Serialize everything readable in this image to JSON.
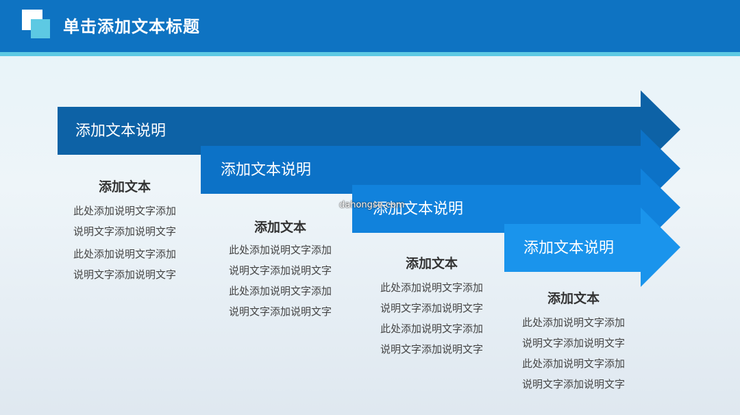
{
  "header": {
    "title": "单击添加文本标题",
    "bar_color": "#0e73c2",
    "stripe_color": "#5dc9e3"
  },
  "steps": [
    {
      "band_label": "添加文本说明",
      "color": "#0d62a6",
      "block_title": "添加文本",
      "lines": [
        "此处添加说明文字添加",
        "说明文字添加说明文字",
        "此处添加说明文字添加",
        "说明文字添加说明文字"
      ]
    },
    {
      "band_label": "添加文本说明",
      "color": "#0c72c7",
      "block_title": "添加文本",
      "lines": [
        "此处添加说明文字添加",
        "说明文字添加说明文字",
        "此处添加说明文字添加",
        "说明文字添加说明文字"
      ]
    },
    {
      "band_label": "添加文本说明",
      "color": "#1182dc",
      "block_title": "添加文本",
      "lines": [
        "此处添加说明文字添加",
        "说明文字添加说明文字",
        "此处添加说明文字添加",
        "说明文字添加说明文字"
      ]
    },
    {
      "band_label": "添加文本说明",
      "color": "#1a94ec",
      "block_title": "添加文本",
      "lines": [
        "此处添加说明文字添加",
        "说明文字添加说明文字",
        "此处添加说明文字添加",
        "说明文字添加说明文字"
      ]
    }
  ],
  "watermark": "dahongse.com"
}
